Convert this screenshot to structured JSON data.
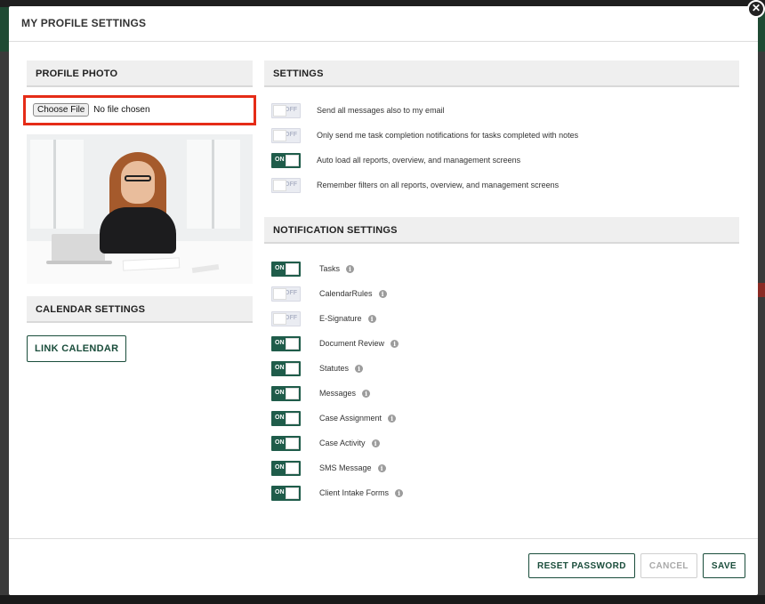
{
  "modal": {
    "title": "MY PROFILE SETTINGS",
    "close_glyph": "✕"
  },
  "profile_photo": {
    "heading": "PROFILE PHOTO",
    "choose_file_label": "Choose File",
    "file_status": "No file chosen"
  },
  "calendar": {
    "heading": "CALENDAR SETTINGS",
    "link_label": "LINK CALENDAR"
  },
  "settings": {
    "heading": "SETTINGS",
    "on_text": "ON",
    "off_text": "OFF",
    "items": [
      {
        "label": "Send all messages also to my email",
        "state": "OFF"
      },
      {
        "label": "Only send me task completion notifications for tasks completed with notes",
        "state": "OFF"
      },
      {
        "label": "Auto load all reports, overview, and management screens",
        "state": "ON"
      },
      {
        "label": "Remember filters on all reports, overview, and management screens",
        "state": "OFF"
      }
    ]
  },
  "notifications": {
    "heading": "NOTIFICATION SETTINGS",
    "info_glyph": "i",
    "items": [
      {
        "label": "Tasks",
        "state": "ON"
      },
      {
        "label": "CalendarRules",
        "state": "OFF"
      },
      {
        "label": "E-Signature",
        "state": "OFF"
      },
      {
        "label": "Document Review",
        "state": "ON"
      },
      {
        "label": "Statutes",
        "state": "ON"
      },
      {
        "label": "Messages",
        "state": "ON"
      },
      {
        "label": "Case Assignment",
        "state": "ON"
      },
      {
        "label": "Case Activity",
        "state": "ON"
      },
      {
        "label": "SMS Message",
        "state": "ON"
      },
      {
        "label": "Client Intake Forms",
        "state": "ON"
      }
    ]
  },
  "footer": {
    "reset_label": "RESET PASSWORD",
    "cancel_label": "CANCEL",
    "save_label": "SAVE"
  },
  "colors": {
    "accent": "#1f5c4a",
    "highlight_red": "#e52c17"
  }
}
